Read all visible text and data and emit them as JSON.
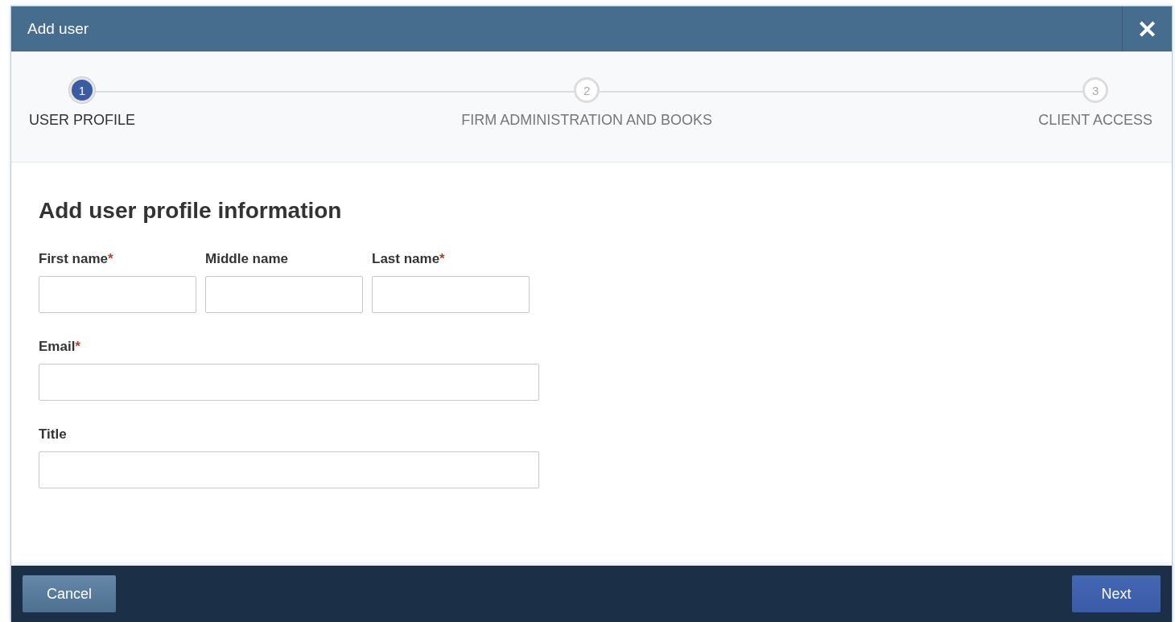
{
  "window": {
    "title": "Add user",
    "close": "✕"
  },
  "steps": [
    {
      "number": "1",
      "label": "USER PROFILE",
      "selected": true
    },
    {
      "number": "2",
      "label": "FIRM ADMINISTRATION AND BOOKS",
      "selected": false
    },
    {
      "number": "3",
      "label": "CLIENT ACCESS",
      "selected": false
    }
  ],
  "heading": "Add user profile information",
  "field_rows": [
    [
      {
        "label": "First name",
        "required_mark": "*"
      },
      {
        "label": "Middle name"
      },
      {
        "label": "Last name",
        "required_mark": "*"
      }
    ],
    [
      {
        "label": "Email",
        "required_mark": "*",
        "wide": true
      }
    ],
    [
      {
        "label": "Title",
        "wide": true
      }
    ]
  ],
  "buttons": {
    "cancel": "Cancel",
    "next": "Next"
  }
}
